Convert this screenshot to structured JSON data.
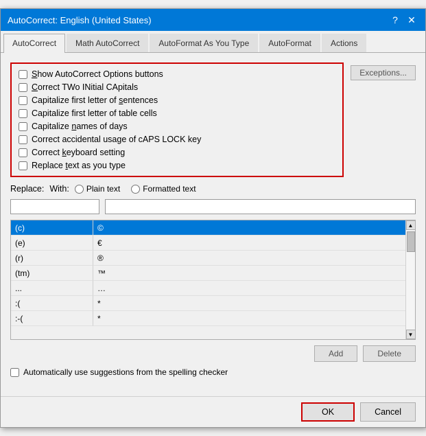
{
  "dialog": {
    "title": "AutoCorrect: English (United States)",
    "help_icon": "?",
    "close_icon": "✕"
  },
  "tabs": [
    {
      "id": "autocorrect",
      "label": "AutoCorrect",
      "active": true
    },
    {
      "id": "math-autocorrect",
      "label": "Math AutoCorrect",
      "active": false
    },
    {
      "id": "autoformat-as-you-type",
      "label": "AutoFormat As You Type",
      "active": false
    },
    {
      "id": "autoformat",
      "label": "AutoFormat",
      "active": false
    },
    {
      "id": "actions",
      "label": "Actions",
      "active": false
    }
  ],
  "checkboxes": [
    {
      "id": "show-autocorrect",
      "label": "Show AutoCorrect Options buttons",
      "checked": false,
      "underline": "S"
    },
    {
      "id": "correct-two",
      "label": "Correct TWo INitial CApitals",
      "checked": false,
      "underline": "C"
    },
    {
      "id": "capitalize-sentences",
      "label": "Capitalize first letter of sentences",
      "checked": false,
      "underline": "a"
    },
    {
      "id": "capitalize-table",
      "label": "Capitalize first letter of table cells",
      "checked": false
    },
    {
      "id": "capitalize-days",
      "label": "Capitalize names of days",
      "checked": false,
      "underline": "n"
    },
    {
      "id": "correct-caps-lock",
      "label": "Correct accidental usage of cAPS LOCK key",
      "checked": false
    },
    {
      "id": "correct-keyboard",
      "label": "Correct keyboard setting",
      "checked": false,
      "underline": "k"
    },
    {
      "id": "replace-text",
      "label": "Replace text as you type",
      "checked": false,
      "underline": "t"
    }
  ],
  "exceptions_btn": "Exceptions...",
  "replace": {
    "replace_label": "Replace:",
    "with_label": "With:",
    "plain_text_label": "Plain text",
    "formatted_text_label": "Formatted text",
    "replace_value": "",
    "with_value": ""
  },
  "table": {
    "rows": [
      {
        "key": "(c)",
        "value": "©",
        "selected": true
      },
      {
        "key": "(e)",
        "value": "€",
        "selected": false
      },
      {
        "key": "(r)",
        "value": "®",
        "selected": false
      },
      {
        "key": "(tm)",
        "value": "™",
        "selected": false
      },
      {
        "key": "...",
        "value": "…",
        "selected": false
      },
      {
        "key": ":(",
        "value": "*",
        "selected": false
      },
      {
        "key": ":-(",
        "value": "*",
        "selected": false
      }
    ]
  },
  "buttons": {
    "add": "Add",
    "delete": "Delete"
  },
  "spelling_checkbox": {
    "label": "Automatically use suggestions from the spelling checker",
    "checked": false
  },
  "bottom_buttons": {
    "ok": "OK",
    "cancel": "Cancel"
  }
}
